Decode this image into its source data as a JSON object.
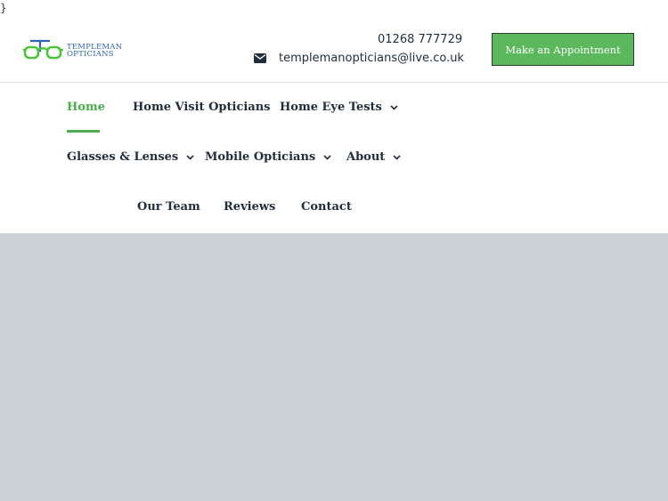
{
  "stray_text": "}",
  "logo": {
    "line1": "TEMPLEMAN",
    "line2": "OPTICIANS"
  },
  "contact": {
    "phone": "01268 777729",
    "email": "templemanopticians@live.co.uk"
  },
  "appointment_button": {
    "label": "Make an Appointment"
  },
  "nav": {
    "home": "Home",
    "home_visit": "Home Visit Opticians",
    "eye_tests": "Home Eye Tests",
    "glasses": "Glasses & Lenses",
    "mobile": "Mobile Opticians",
    "about": "About",
    "team": "Our Team",
    "reviews": "Reviews",
    "contact": "Contact"
  },
  "colors": {
    "accent": "#4cae4c",
    "button": "#5cb85c",
    "logo_blue": "#2a63b8",
    "logo_green": "#4cc43a",
    "text": "#1f2d3d",
    "hero_bg": "#cbd1d4"
  },
  "icons": {
    "email": "envelope-icon",
    "dropdown": "chevron-down-icon"
  }
}
